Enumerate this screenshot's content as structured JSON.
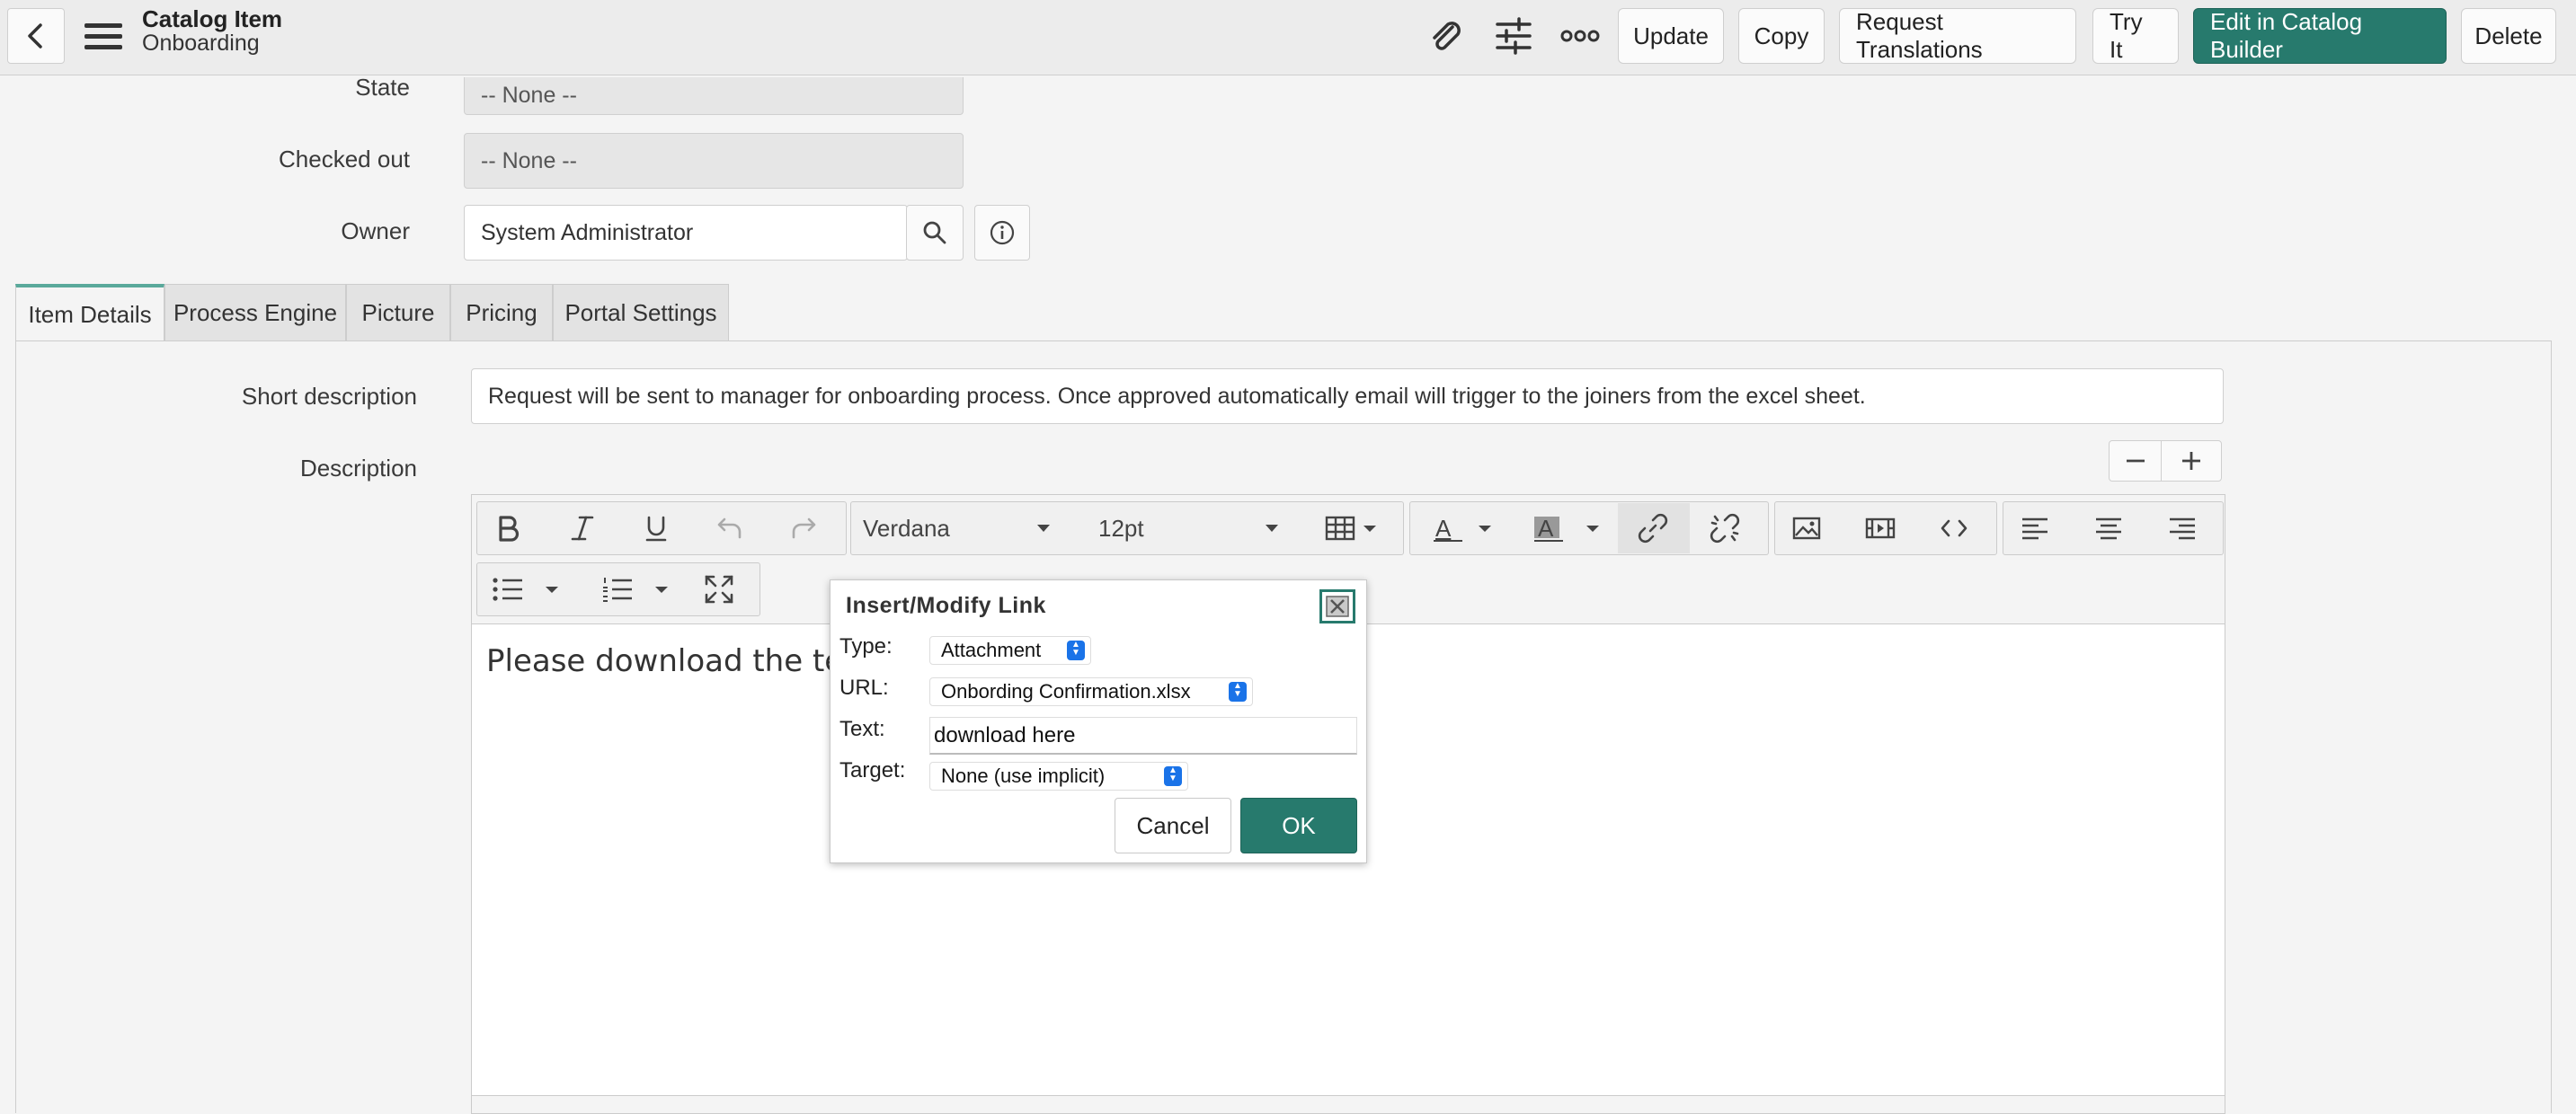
{
  "header": {
    "title": "Catalog Item",
    "subtitle": "Onboarding",
    "buttons": {
      "update": "Update",
      "copy": "Copy",
      "request_translations": "Request Translations",
      "try_it": "Try It",
      "edit_in_builder": "Edit in Catalog Builder",
      "delete": "Delete"
    },
    "icons": [
      "back-arrow-icon",
      "hamburger-menu-icon",
      "paperclip-icon",
      "sliders-icon",
      "more-options-icon"
    ]
  },
  "form": {
    "state_label": "State",
    "state_value": "-- None --",
    "checked_out_label": "Checked out",
    "checked_out_value": "-- None --",
    "owner_label": "Owner",
    "owner_value": "System Administrator"
  },
  "tabs": [
    "Item Details",
    "Process Engine",
    "Picture",
    "Pricing",
    "Portal Settings"
  ],
  "details": {
    "short_description_label": "Short description",
    "short_description_value": "Request will be sent to manager for onboarding process. Once approved automatically email will trigger to the joiners from the excel sheet.",
    "description_label": "Description"
  },
  "editor": {
    "font_family": "Verdana",
    "font_size": "12pt",
    "content_text": "Please download the ter"
  },
  "dialog": {
    "title": "Insert/Modify Link",
    "type_label": "Type:",
    "type_value": "Attachment",
    "url_label": "URL:",
    "url_value": "Onbording Confirmation.xlsx",
    "text_label": "Text:",
    "text_value": "download here",
    "target_label": "Target:",
    "target_value": "None (use implicit)",
    "cancel_label": "Cancel",
    "ok_label": "OK"
  },
  "colors": {
    "accent": "#277a6d",
    "select_spinner": "#1a73e8"
  }
}
